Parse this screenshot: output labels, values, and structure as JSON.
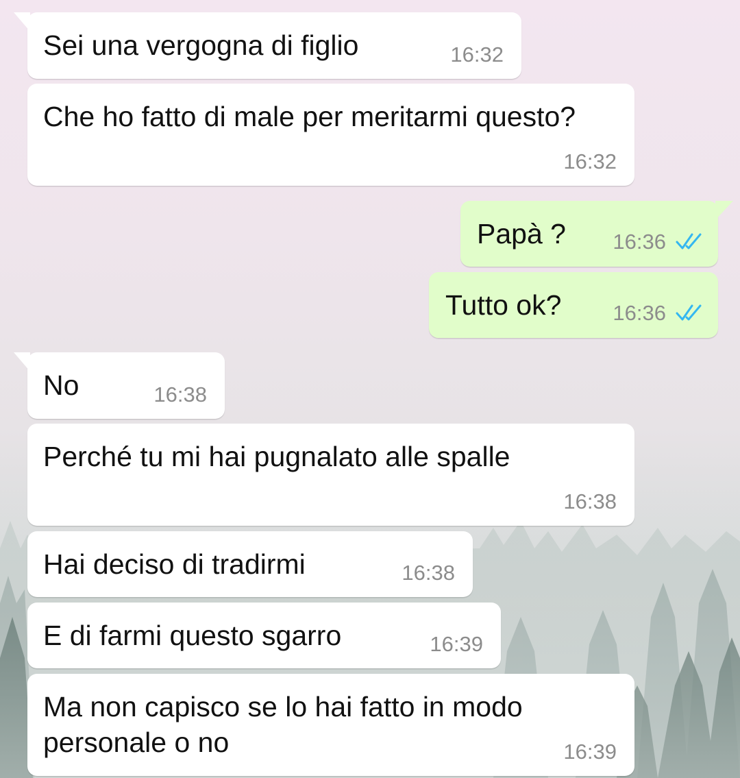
{
  "chat": {
    "messages": [
      {
        "text": "Sei una vergogna di figlio",
        "time": "16:32",
        "direction": "incoming"
      },
      {
        "text": "Che ho fatto di male per meritarmi questo?",
        "time": "16:32",
        "direction": "incoming"
      },
      {
        "text": "Papà ?",
        "time": "16:36",
        "direction": "outgoing",
        "status": "read"
      },
      {
        "text": "Tutto ok?",
        "time": "16:36",
        "direction": "outgoing",
        "status": "read"
      },
      {
        "text": "No",
        "time": "16:38",
        "direction": "incoming"
      },
      {
        "text": "Perché tu mi hai pugnalato alle spalle",
        "time": "16:38",
        "direction": "incoming"
      },
      {
        "text": "Hai deciso di tradirmi",
        "time": "16:38",
        "direction": "incoming"
      },
      {
        "text": "E di farmi questo sgarro",
        "time": "16:39",
        "direction": "incoming"
      },
      {
        "text": "Ma non capisco se lo hai fatto in modo",
        "text_line2": "personale o no",
        "time": "16:39",
        "direction": "incoming"
      }
    ]
  },
  "colors": {
    "incoming_bubble": "#ffffff",
    "outgoing_bubble": "#e1fdca",
    "read_ticks": "#34b7f1",
    "timestamp": "#8c8c8c"
  },
  "icons": {
    "read_receipt": "double-check-icon",
    "background": "misty-forest-wallpaper"
  }
}
